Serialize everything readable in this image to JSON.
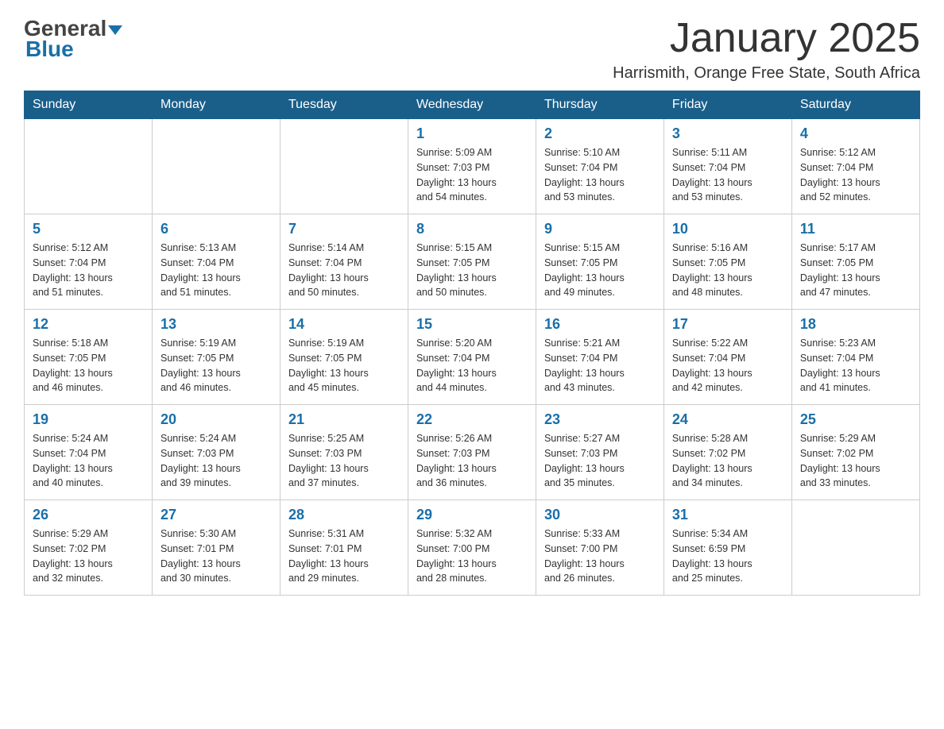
{
  "header": {
    "month_title": "January 2025",
    "location": "Harrismith, Orange Free State, South Africa",
    "logo_general": "General",
    "logo_blue": "Blue"
  },
  "weekdays": [
    "Sunday",
    "Monday",
    "Tuesday",
    "Wednesday",
    "Thursday",
    "Friday",
    "Saturday"
  ],
  "weeks": [
    [
      {
        "day": "",
        "info": ""
      },
      {
        "day": "",
        "info": ""
      },
      {
        "day": "",
        "info": ""
      },
      {
        "day": "1",
        "info": "Sunrise: 5:09 AM\nSunset: 7:03 PM\nDaylight: 13 hours\nand 54 minutes."
      },
      {
        "day": "2",
        "info": "Sunrise: 5:10 AM\nSunset: 7:04 PM\nDaylight: 13 hours\nand 53 minutes."
      },
      {
        "day": "3",
        "info": "Sunrise: 5:11 AM\nSunset: 7:04 PM\nDaylight: 13 hours\nand 53 minutes."
      },
      {
        "day": "4",
        "info": "Sunrise: 5:12 AM\nSunset: 7:04 PM\nDaylight: 13 hours\nand 52 minutes."
      }
    ],
    [
      {
        "day": "5",
        "info": "Sunrise: 5:12 AM\nSunset: 7:04 PM\nDaylight: 13 hours\nand 51 minutes."
      },
      {
        "day": "6",
        "info": "Sunrise: 5:13 AM\nSunset: 7:04 PM\nDaylight: 13 hours\nand 51 minutes."
      },
      {
        "day": "7",
        "info": "Sunrise: 5:14 AM\nSunset: 7:04 PM\nDaylight: 13 hours\nand 50 minutes."
      },
      {
        "day": "8",
        "info": "Sunrise: 5:15 AM\nSunset: 7:05 PM\nDaylight: 13 hours\nand 50 minutes."
      },
      {
        "day": "9",
        "info": "Sunrise: 5:15 AM\nSunset: 7:05 PM\nDaylight: 13 hours\nand 49 minutes."
      },
      {
        "day": "10",
        "info": "Sunrise: 5:16 AM\nSunset: 7:05 PM\nDaylight: 13 hours\nand 48 minutes."
      },
      {
        "day": "11",
        "info": "Sunrise: 5:17 AM\nSunset: 7:05 PM\nDaylight: 13 hours\nand 47 minutes."
      }
    ],
    [
      {
        "day": "12",
        "info": "Sunrise: 5:18 AM\nSunset: 7:05 PM\nDaylight: 13 hours\nand 46 minutes."
      },
      {
        "day": "13",
        "info": "Sunrise: 5:19 AM\nSunset: 7:05 PM\nDaylight: 13 hours\nand 46 minutes."
      },
      {
        "day": "14",
        "info": "Sunrise: 5:19 AM\nSunset: 7:05 PM\nDaylight: 13 hours\nand 45 minutes."
      },
      {
        "day": "15",
        "info": "Sunrise: 5:20 AM\nSunset: 7:04 PM\nDaylight: 13 hours\nand 44 minutes."
      },
      {
        "day": "16",
        "info": "Sunrise: 5:21 AM\nSunset: 7:04 PM\nDaylight: 13 hours\nand 43 minutes."
      },
      {
        "day": "17",
        "info": "Sunrise: 5:22 AM\nSunset: 7:04 PM\nDaylight: 13 hours\nand 42 minutes."
      },
      {
        "day": "18",
        "info": "Sunrise: 5:23 AM\nSunset: 7:04 PM\nDaylight: 13 hours\nand 41 minutes."
      }
    ],
    [
      {
        "day": "19",
        "info": "Sunrise: 5:24 AM\nSunset: 7:04 PM\nDaylight: 13 hours\nand 40 minutes."
      },
      {
        "day": "20",
        "info": "Sunrise: 5:24 AM\nSunset: 7:03 PM\nDaylight: 13 hours\nand 39 minutes."
      },
      {
        "day": "21",
        "info": "Sunrise: 5:25 AM\nSunset: 7:03 PM\nDaylight: 13 hours\nand 37 minutes."
      },
      {
        "day": "22",
        "info": "Sunrise: 5:26 AM\nSunset: 7:03 PM\nDaylight: 13 hours\nand 36 minutes."
      },
      {
        "day": "23",
        "info": "Sunrise: 5:27 AM\nSunset: 7:03 PM\nDaylight: 13 hours\nand 35 minutes."
      },
      {
        "day": "24",
        "info": "Sunrise: 5:28 AM\nSunset: 7:02 PM\nDaylight: 13 hours\nand 34 minutes."
      },
      {
        "day": "25",
        "info": "Sunrise: 5:29 AM\nSunset: 7:02 PM\nDaylight: 13 hours\nand 33 minutes."
      }
    ],
    [
      {
        "day": "26",
        "info": "Sunrise: 5:29 AM\nSunset: 7:02 PM\nDaylight: 13 hours\nand 32 minutes."
      },
      {
        "day": "27",
        "info": "Sunrise: 5:30 AM\nSunset: 7:01 PM\nDaylight: 13 hours\nand 30 minutes."
      },
      {
        "day": "28",
        "info": "Sunrise: 5:31 AM\nSunset: 7:01 PM\nDaylight: 13 hours\nand 29 minutes."
      },
      {
        "day": "29",
        "info": "Sunrise: 5:32 AM\nSunset: 7:00 PM\nDaylight: 13 hours\nand 28 minutes."
      },
      {
        "day": "30",
        "info": "Sunrise: 5:33 AM\nSunset: 7:00 PM\nDaylight: 13 hours\nand 26 minutes."
      },
      {
        "day": "31",
        "info": "Sunrise: 5:34 AM\nSunset: 6:59 PM\nDaylight: 13 hours\nand 25 minutes."
      },
      {
        "day": "",
        "info": ""
      }
    ]
  ]
}
